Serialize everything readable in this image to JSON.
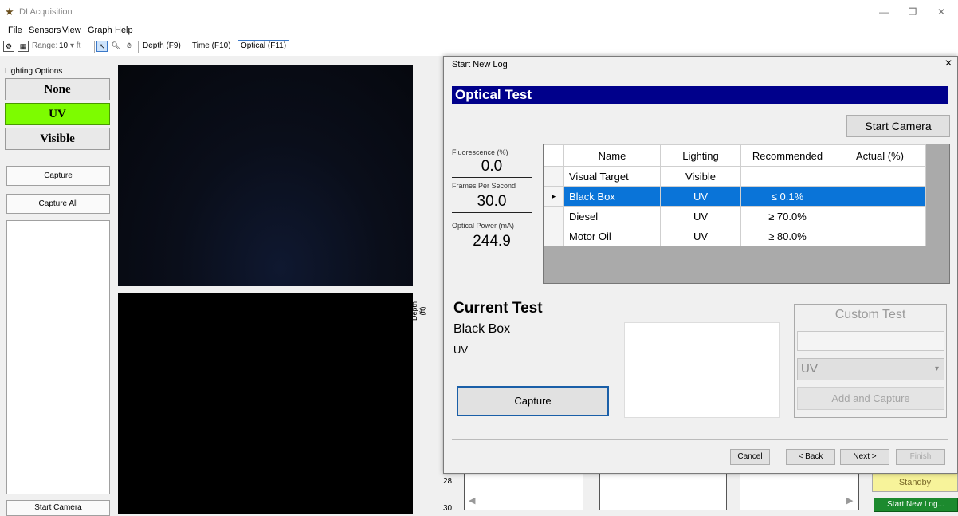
{
  "window": {
    "title": "DI Acquisition",
    "minimize": "—",
    "maximize": "❐",
    "close": "✕"
  },
  "menu": [
    "File",
    "Sensors",
    "View",
    "Graph",
    "Help"
  ],
  "toolbar": {
    "range_label": "Range:",
    "range_value": "10",
    "range_unit": "▾ ft",
    "views": [
      "Depth (F9)",
      "Time (F10)",
      "Optical (F11)"
    ],
    "active_view": "Optical (F11)"
  },
  "lighting": {
    "label": "Lighting Options",
    "options": [
      "None",
      "UV",
      "Visible"
    ],
    "selected": "UV",
    "selected_color": "#7dfc00"
  },
  "left_buttons": {
    "capture": "Capture",
    "capture_all": "Capture All",
    "start_camera": "Start Camera"
  },
  "graph": {
    "axis_label": "Depth (ft)",
    "ticks": [
      "28",
      "30"
    ],
    "standby": "Standby",
    "start_new_log": "Start New Log..."
  },
  "dialog": {
    "title": "Start New Log",
    "header": "Optical Test",
    "start_camera": "Start Camera",
    "metrics": [
      {
        "label": "Fluorescence (%)",
        "value": "0.0"
      },
      {
        "label": "Frames Per Second",
        "value": "30.0"
      },
      {
        "label": "Optical Power (mA)",
        "value": "244.9"
      }
    ],
    "table": {
      "columns": [
        "Name",
        "Lighting",
        "Recommended",
        "Actual (%)"
      ],
      "rows": [
        {
          "name": "Visual Target",
          "lighting": "Visible",
          "recommended": "",
          "actual": ""
        },
        {
          "name": "Black Box",
          "lighting": "UV",
          "recommended": "≤ 0.1%",
          "actual": ""
        },
        {
          "name": "Diesel",
          "lighting": "UV",
          "recommended": "≥ 70.0%",
          "actual": ""
        },
        {
          "name": "Motor Oil",
          "lighting": "UV",
          "recommended": "≥ 80.0%",
          "actual": ""
        }
      ],
      "selected_row_marker": "▸",
      "selection_color": "#0a74d8"
    },
    "current_test": {
      "title": "Current Test",
      "name": "Black Box",
      "lighting": "UV",
      "capture": "Capture"
    },
    "custom_test": {
      "title": "Custom Test",
      "input_value": "",
      "lighting": "UV",
      "add": "Add and Capture"
    },
    "footer": {
      "cancel": "Cancel",
      "back": "< Back",
      "next": "Next >",
      "finish": "Finish"
    }
  }
}
